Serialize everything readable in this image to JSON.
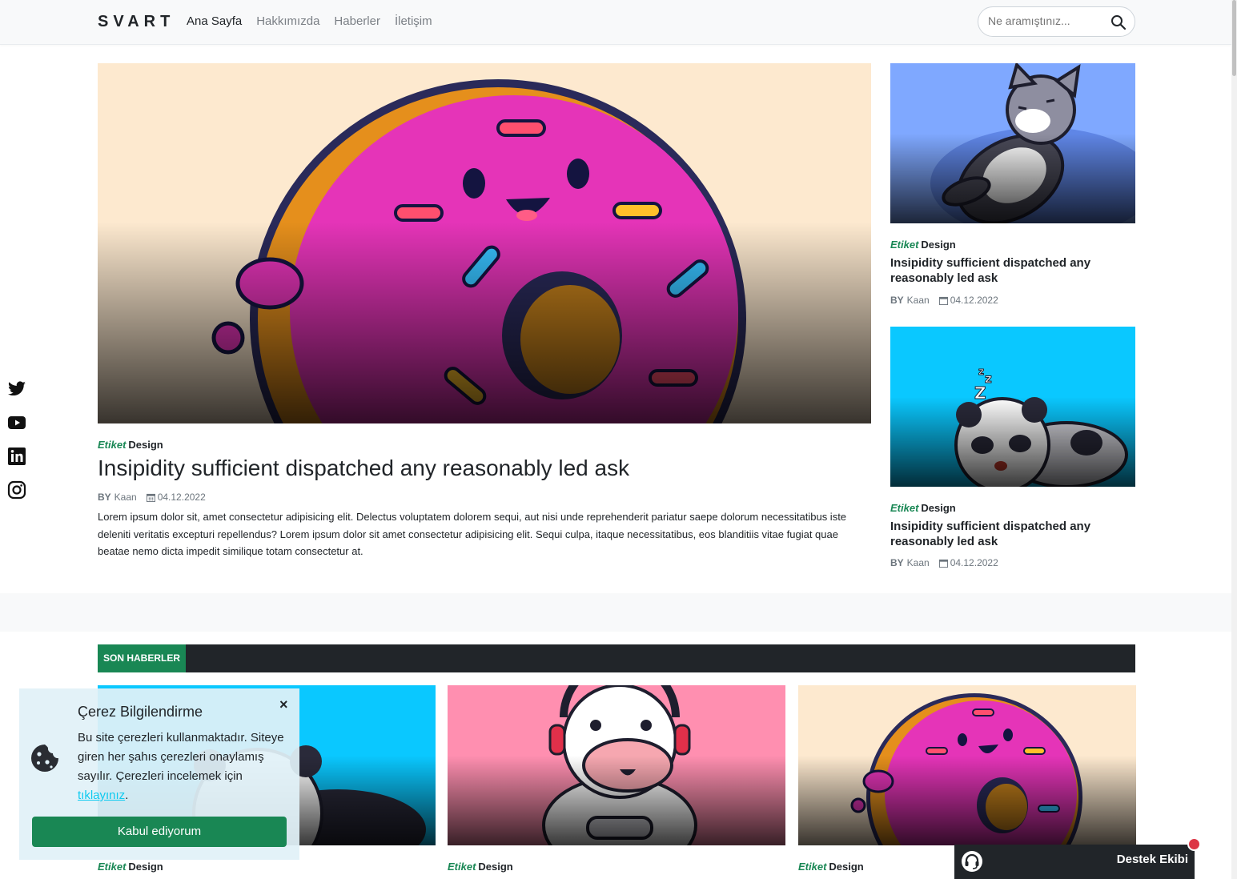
{
  "nav": {
    "brand": "SVART",
    "links": [
      "Ana Sayfa",
      "Hakkımızda",
      "Haberler",
      "İletişim"
    ],
    "search_placeholder": "Ne aramıştınız..."
  },
  "social": [
    "twitter-icon",
    "youtube-icon",
    "linkedin-icon",
    "instagram-icon"
  ],
  "hero": {
    "tag_label": "Etiket",
    "tag": "Design",
    "title": "Insipidity sufficient dispatched any reasonably led ask",
    "by": "BY",
    "author": "Kaan",
    "date": "04.12.2022",
    "body": "Lorem ipsum dolor sit, amet consectetur adipisicing elit. Delectus voluptatem dolorem sequi, aut nisi unde reprehenderit pariatur saepe dolorum necessitatibus iste deleniti veritatis excepturi repellendus? Lorem ipsum dolor sit amet consectetur adipisicing elit. Sequi culpa, itaque necessitatibus, eos blanditiis vitae fugiat quae beatae nemo dicta impedit similique totam consectetur at."
  },
  "side_cards": [
    {
      "tag_label": "Etiket",
      "tag": "Design",
      "title": "Insipidity sufficient dispatched any reasonably led ask",
      "by": "BY",
      "author": "Kaan",
      "date": "04.12.2022",
      "image": "sleeping-cat"
    },
    {
      "tag_label": "Etiket",
      "tag": "Design",
      "title": "Insipidity sufficient dispatched any reasonably led ask",
      "by": "BY",
      "author": "Kaan",
      "date": "04.12.2022",
      "image": "sleeping-panda"
    }
  ],
  "latest": {
    "label": "SON HABERLER",
    "cards": [
      {
        "tag_label": "Etiket",
        "tag": "Design",
        "image": "panda"
      },
      {
        "tag_label": "Etiket",
        "tag": "Design",
        "image": "gamer-cow"
      },
      {
        "tag_label": "Etiket",
        "tag": "Design",
        "image": "donut"
      }
    ]
  },
  "cookie": {
    "title": "Çerez Bilgilendirme",
    "text": "Bu site çerezleri kullanmaktadır. Siteye giren her şahıs çerezleri onaylamış sayılır. Çerezleri incelemek için",
    "link": "tıklayınız",
    "suffix": ".",
    "close": "×",
    "button": "Kabul ediyorum"
  },
  "support": {
    "label": "Destek Ekibi"
  },
  "colors": {
    "accent": "#198754",
    "dark": "#212529",
    "link": "#0dcaf0",
    "alert": "#dc3545"
  }
}
